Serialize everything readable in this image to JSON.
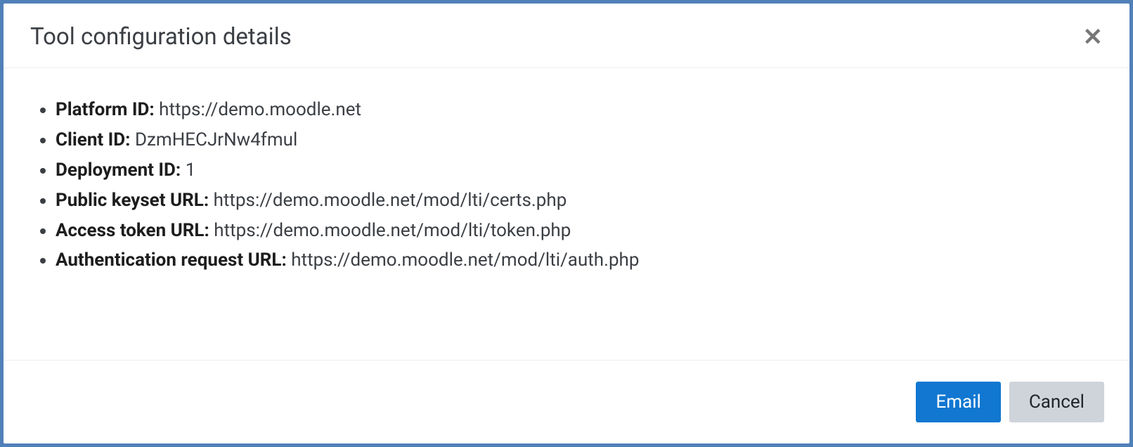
{
  "modal": {
    "title": "Tool configuration details",
    "fields": [
      {
        "label": "Platform ID:",
        "value": "https://demo.moodle.net"
      },
      {
        "label": "Client ID:",
        "value": "DzmHECJrNw4fmul"
      },
      {
        "label": "Deployment ID:",
        "value": "1"
      },
      {
        "label": "Public keyset URL:",
        "value": "https://demo.moodle.net/mod/lti/certs.php"
      },
      {
        "label": "Access token URL:",
        "value": "https://demo.moodle.net/mod/lti/token.php"
      },
      {
        "label": "Authentication request URL:",
        "value": "https://demo.moodle.net/mod/lti/auth.php"
      }
    ],
    "buttons": {
      "email": "Email",
      "cancel": "Cancel"
    }
  }
}
